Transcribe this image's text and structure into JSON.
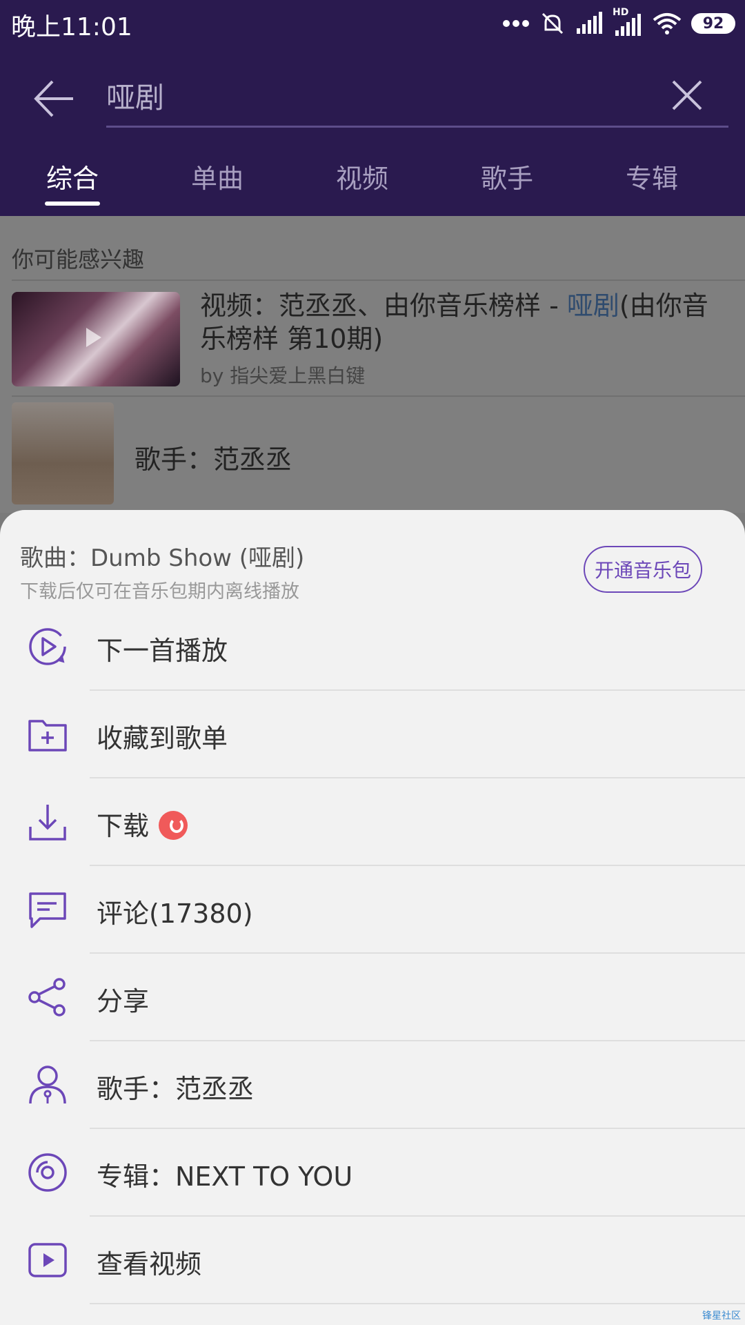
{
  "status_bar": {
    "time": "晚上11:01",
    "battery": "92",
    "network": "HD"
  },
  "search": {
    "query": "哑剧"
  },
  "tabs": [
    {
      "label": "综合",
      "active": true
    },
    {
      "label": "单曲",
      "active": false
    },
    {
      "label": "视频",
      "active": false
    },
    {
      "label": "歌手",
      "active": false
    },
    {
      "label": "专辑",
      "active": false
    }
  ],
  "suggestions": {
    "section_title": "你可能感兴趣",
    "video": {
      "title_prefix": "视频：范丞丞、由你音乐榜样 - ",
      "title_highlight": "哑剧",
      "title_suffix": "(由你音乐榜样 第10期)",
      "by": "by 指尖爱上黑白键"
    },
    "singer": {
      "label": "歌手：范丞丞"
    }
  },
  "sheet": {
    "title": "歌曲：Dumb Show (哑剧)",
    "subtitle": "下载后仅可在音乐包期内离线播放",
    "pkg_button": "开通音乐包",
    "items": [
      {
        "label": "下一首播放",
        "icon": "play-next-icon"
      },
      {
        "label": "收藏到歌单",
        "icon": "folder-add-icon"
      },
      {
        "label": "下载",
        "icon": "download-icon"
      },
      {
        "label": "评论(17380)",
        "icon": "comment-icon"
      },
      {
        "label": "分享",
        "icon": "share-icon"
      },
      {
        "label": "歌手：范丞丞",
        "icon": "singer-icon"
      },
      {
        "label": "专辑：NEXT TO YOU",
        "icon": "album-icon"
      },
      {
        "label": "查看视频",
        "icon": "video-icon"
      }
    ]
  },
  "watermark": "锋星社区",
  "colors": {
    "header": "#2a1a4f",
    "accent": "#6c47b8",
    "badge": "#f05a5a"
  }
}
